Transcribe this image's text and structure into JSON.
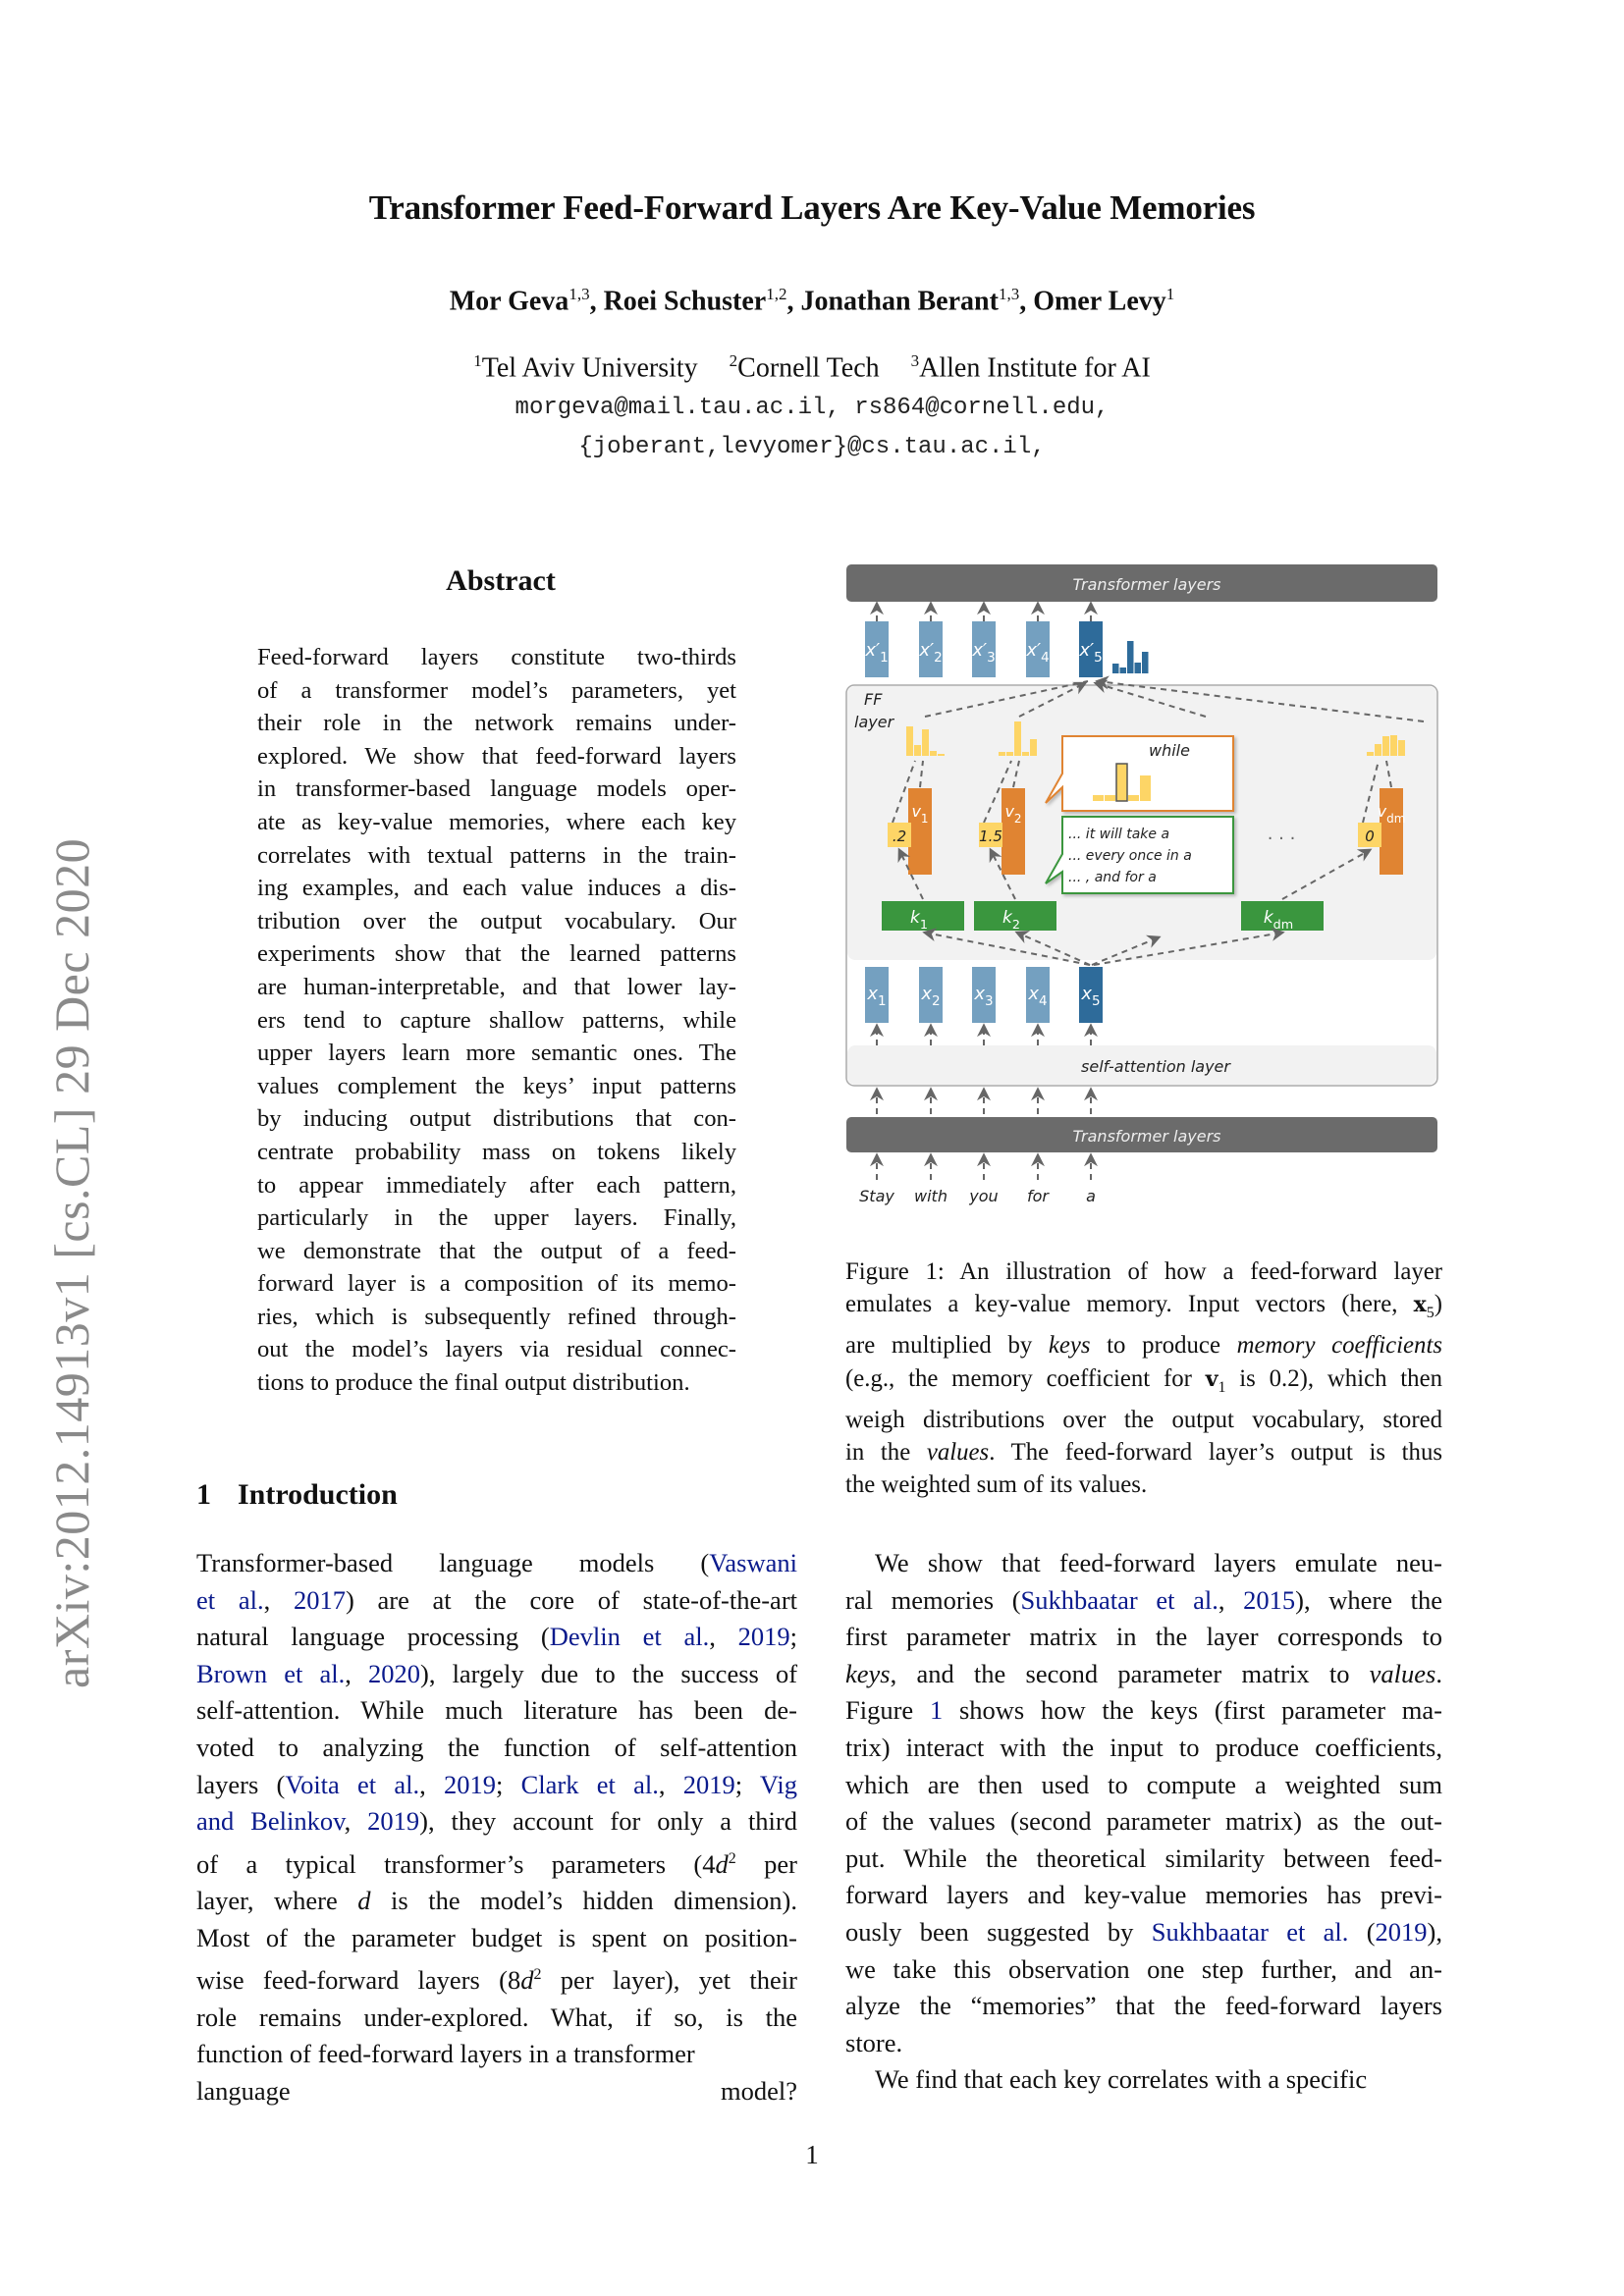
{
  "paper": {
    "title": "Transformer Feed-Forward Layers Are Key-Value Memories",
    "authors": [
      {
        "name": "Mor Geva",
        "affil": "1,3"
      },
      {
        "name": "Roei Schuster",
        "affil": "1,2"
      },
      {
        "name": "Jonathan Berant",
        "affil": "1,3"
      },
      {
        "name": "Omer Levy",
        "affil": "1"
      }
    ],
    "affiliations": [
      {
        "num": "1",
        "name": "Tel Aviv University"
      },
      {
        "num": "2",
        "name": "Cornell Tech"
      },
      {
        "num": "3",
        "name": "Allen Institute for AI"
      }
    ],
    "emails_line1": "morgeva@mail.tau.ac.il,  rs864@cornell.edu,",
    "emails_line2": "{joberant,levyomer}@cs.tau.ac.il,",
    "arxiv_stamp": "arXiv:2012.14913v1  [cs.CL]  29 Dec 2020",
    "page_number": "1"
  },
  "abstract": {
    "heading": "Abstract",
    "lines": [
      "Feed-forward layers constitute two-thirds",
      "of a transformer model’s parameters, yet",
      "their role in the network remains under-",
      "explored. We show that feed-forward layers",
      "in transformer-based language models oper-",
      "ate as key-value memories, where each key",
      "correlates with textual patterns in the train-",
      "ing examples, and each value induces a dis-",
      "tribution over the output vocabulary.  Our",
      "experiments show that the learned patterns",
      "are human-interpretable, and that lower lay-",
      "ers tend to capture shallow patterns, while",
      "upper layers learn more semantic ones. The",
      "values complement the keys’ input patterns",
      "by inducing output distributions that con-",
      "centrate probability mass on tokens likely",
      "to appear immediately after each pattern,",
      "particularly in the upper layers.  Finally,",
      "we demonstrate that the output of a feed-",
      "forward layer is a composition of its memo-",
      "ries, which is subsequently refined through-",
      "out the model’s layers via residual connec-",
      "tions to produce the final output distribution."
    ]
  },
  "introduction": {
    "number": "1",
    "heading": "Introduction",
    "left_lines": [
      [
        {
          "t": "Transformer-based language models ("
        },
        {
          "t": "Vaswani",
          "cite": true
        }
      ],
      [
        {
          "t": "et al.",
          "cite": true
        },
        {
          "t": ", "
        },
        {
          "t": "2017",
          "cite": true
        },
        {
          "t": ") are at the core of state-of-the-art"
        }
      ],
      [
        {
          "t": "natural language processing ("
        },
        {
          "t": "Devlin et al.",
          "cite": true
        },
        {
          "t": ", "
        },
        {
          "t": "2019",
          "cite": true
        },
        {
          "t": ";"
        }
      ],
      [
        {
          "t": "Brown et al.",
          "cite": true
        },
        {
          "t": ", "
        },
        {
          "t": "2020",
          "cite": true
        },
        {
          "t": "), largely due to the success of"
        }
      ],
      [
        {
          "t": "self-attention. While much literature has been de-"
        }
      ],
      [
        {
          "t": "voted to analyzing the function of self-attention"
        }
      ],
      [
        {
          "t": "layers ("
        },
        {
          "t": "Voita et al.",
          "cite": true
        },
        {
          "t": ", "
        },
        {
          "t": "2019",
          "cite": true
        },
        {
          "t": "; "
        },
        {
          "t": "Clark et al.",
          "cite": true
        },
        {
          "t": ", "
        },
        {
          "t": "2019",
          "cite": true
        },
        {
          "t": "; "
        },
        {
          "t": "Vig",
          "cite": true
        }
      ],
      [
        {
          "t": "and Belinkov",
          "cite": true
        },
        {
          "t": ", "
        },
        {
          "t": "2019",
          "cite": true
        },
        {
          "t": "), they account for only a third"
        }
      ],
      [
        {
          "t": "of a typical transformer’s parameters ("
        },
        {
          "t": "4",
          "math": true
        },
        {
          "t": "d",
          "math": true,
          "ital": true
        },
        {
          "t": "2",
          "sup": true
        },
        {
          "t": " per"
        }
      ],
      [
        {
          "t": "layer, where "
        },
        {
          "t": "d",
          "ital": true
        },
        {
          "t": " is the model’s hidden dimension)."
        }
      ],
      [
        {
          "t": "Most of the parameter budget is spent on position-"
        }
      ],
      [
        {
          "t": "wise feed-forward layers ("
        },
        {
          "t": "8"
        },
        {
          "t": "d",
          "ital": true
        },
        {
          "t": "2",
          "sup": true
        },
        {
          "t": " per layer), yet their"
        }
      ],
      [
        {
          "t": "role remains under-explored.  What, if so, is the"
        }
      ],
      [
        {
          "t": "function of feed-forward layers in a transformer"
        }
      ],
      [
        {
          "t": "language model?"
        }
      ]
    ],
    "right_lines": [
      [
        {
          "t": "We show that feed-forward layers emulate neu-"
        }
      ],
      [
        {
          "t": "ral memories ("
        },
        {
          "t": "Sukhbaatar et al.",
          "cite": true
        },
        {
          "t": ", "
        },
        {
          "t": "2015",
          "cite": true
        },
        {
          "t": "), where the"
        }
      ],
      [
        {
          "t": "first parameter matrix in the layer corresponds to"
        }
      ],
      [
        {
          "t": "keys",
          "ital": true
        },
        {
          "t": ", and the second parameter matrix to "
        },
        {
          "t": "values",
          "ital": true
        },
        {
          "t": "."
        }
      ],
      [
        {
          "t": "Figure "
        },
        {
          "t": "1",
          "cite": true
        },
        {
          "t": " shows how the keys (first parameter ma-"
        }
      ],
      [
        {
          "t": "trix) interact with the input to produce coefficients,"
        }
      ],
      [
        {
          "t": "which are then used to compute a weighted sum"
        }
      ],
      [
        {
          "t": "of the values (second parameter matrix) as the out-"
        }
      ],
      [
        {
          "t": "put. While the theoretical similarity between feed-"
        }
      ],
      [
        {
          "t": "forward layers and key-value memories has previ-"
        }
      ],
      [
        {
          "t": "ously been suggested by "
        },
        {
          "t": "Sukhbaatar et al.",
          "cite": true
        },
        {
          "t": " ("
        },
        {
          "t": "2019",
          "cite": true
        },
        {
          "t": "),"
        }
      ],
      [
        {
          "t": "we take this observation one step further, and an-"
        }
      ],
      [
        {
          "t": "alyze the “memories” that the feed-forward layers"
        }
      ],
      [
        {
          "t": "store."
        }
      ],
      [
        {
          "t": "We find that each key correlates with a specific"
        }
      ]
    ]
  },
  "figure": {
    "caption_lines": [
      [
        {
          "t": "Figure 1:  An illustration of how a feed-forward layer"
        }
      ],
      [
        {
          "t": "emulates a key-value memory. Input vectors (here, "
        },
        {
          "t": "x",
          "bold": true
        },
        {
          "t": "5",
          "sub": true
        },
        {
          "t": ")"
        }
      ],
      [
        {
          "t": "are multiplied by "
        },
        {
          "t": "keys",
          "ital": true
        },
        {
          "t": " to produce "
        },
        {
          "t": "memory coefficients",
          "ital": true
        }
      ],
      [
        {
          "t": "(e.g., the memory coefficient for "
        },
        {
          "t": "v",
          "bold": true
        },
        {
          "t": "1",
          "sub": true
        },
        {
          "t": " is 0.2), which then"
        }
      ],
      [
        {
          "t": "weigh distributions over the output vocabulary, stored"
        }
      ],
      [
        {
          "t": "in the "
        },
        {
          "t": "values",
          "ital": true
        },
        {
          "t": ".  The feed-forward layer’s output is thus"
        }
      ],
      [
        {
          "t": "the weighted sum of its values."
        }
      ]
    ],
    "top_bar_label": "Transformer layers",
    "bottom_bar_label": "Transformer layers",
    "self_attention_label": "self-attention layer",
    "ff_label_line1": "FF",
    "ff_label_line2": "layer",
    "output_vectors": [
      "x'1",
      "x'2",
      "x'3",
      "x'4",
      "x'5"
    ],
    "input_vectors": [
      "x1",
      "x2",
      "x3",
      "x4",
      "x5"
    ],
    "input_tokens": [
      "Stay",
      "with",
      "you",
      "for",
      "a"
    ],
    "keys": [
      {
        "base": "k",
        "sub": "1"
      },
      {
        "base": "k",
        "sub": "2"
      },
      {
        "base": "k",
        "sub": "dm"
      }
    ],
    "values": [
      {
        "base": "v",
        "sub": "1"
      },
      {
        "base": "v",
        "sub": "2"
      },
      {
        "base": "v",
        "sub": "dm"
      }
    ],
    "coefficients": [
      ".2",
      "1.5",
      "0"
    ],
    "ellipsis": "· · ·",
    "value_callout_word": "while",
    "key_callout_lines": [
      "... it will take a",
      "... every once in a",
      "... , and for a"
    ],
    "colors": {
      "transformer_bar": "#6b6b6b",
      "vector_light": "#74a0c0",
      "vector_dark": "#2e6b9a",
      "key_green": "#3a963e",
      "value_orange": "#e08432",
      "coef_yellow": "#fdd566",
      "panel_grey": "#f2f2f2",
      "citation_blue": "#0a1a8c"
    }
  }
}
